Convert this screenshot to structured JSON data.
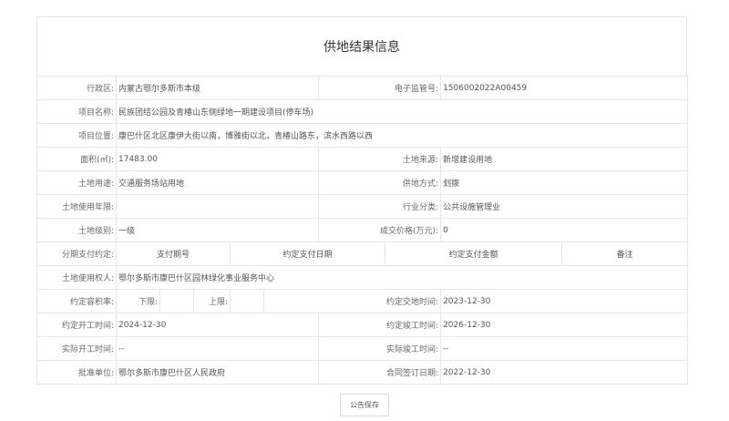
{
  "page_title": "供地结果信息",
  "row1": {
    "l1": "行政区:",
    "v1": "内蒙古鄂尔多斯市本级",
    "l2": "电子监管号:",
    "v2": "1506002022A00459"
  },
  "row2": {
    "l1": "项目名称:",
    "v1": "民族团结公园及青椿山东侧绿地一期建设项目(停车场)"
  },
  "row3": {
    "l1": "项目位置:",
    "v1": "康巴什区北区康伊大街以南，博雅街以北，青椿山路东，滨水西路以西"
  },
  "row4": {
    "l1": "面积(㎡):",
    "v1": "17483.00",
    "l2": "土地来源:",
    "v2": "新增建设用地"
  },
  "row5": {
    "l1": "土地用途:",
    "v1": "交通服务场站用地",
    "l2": "供地方式:",
    "v2": "划拨"
  },
  "row6": {
    "l1": "土地使用年限:",
    "v1": "",
    "l2": "行业分类:",
    "v2": "公共设施管理业"
  },
  "row7": {
    "l1": "土地级别:",
    "v1": "一级",
    "l2": "成交价格(万元):",
    "v2": "0"
  },
  "row8": {
    "l1": "分期支付约定:",
    "h1": "支付期号",
    "h2": "约定支付日期",
    "h3": "约定支付金额",
    "h4": "备注"
  },
  "row9": {
    "l1": "土地使用权人:",
    "v1": "鄂尔多斯市康巴什区园林绿化事业服务中心"
  },
  "row10": {
    "l1": "约定容积率:",
    "lo_label": "下限:",
    "lo_val": "",
    "hi_label": "上限:",
    "hi_val": "",
    "l2": "约定交地时间:",
    "v2": "2023-12-30"
  },
  "row11": {
    "l1": "约定开工时间:",
    "v1": "2024-12-30",
    "l2": "约定竣工时间:",
    "v2": "2026-12-30"
  },
  "row12": {
    "l1": "实际开工时间:",
    "v1": "--",
    "l2": "实际竣工时间:",
    "v2": "--"
  },
  "row13": {
    "l1": "批准单位:",
    "v1": "鄂尔多斯市康巴什区人民政府",
    "l2": "合同签订日期:",
    "v2": "2022-12-30"
  },
  "save_button_label": "公告保存"
}
